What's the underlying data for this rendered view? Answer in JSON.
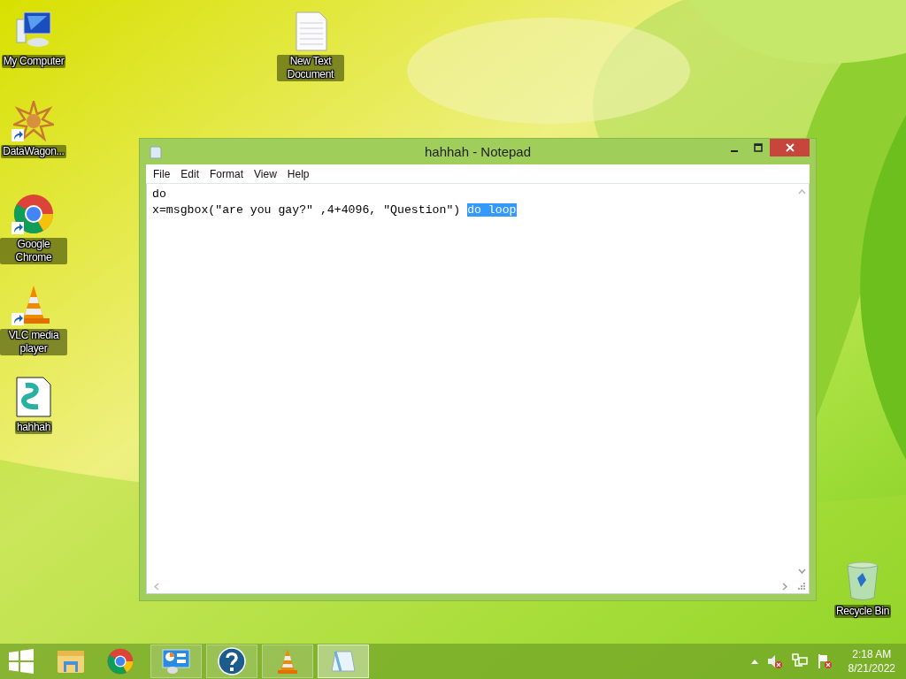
{
  "desktop_icons": [
    {
      "label": "My Computer",
      "shortcut": false
    },
    {
      "label": "DataWagon...",
      "shortcut": true
    },
    {
      "label": "Google Chrome",
      "shortcut": true
    },
    {
      "label": "VLC media player",
      "shortcut": true
    },
    {
      "label": "hahhah",
      "shortcut": false
    },
    {
      "label": "New Text Document",
      "shortcut": false
    },
    {
      "label": "Recycle Bin",
      "shortcut": false
    }
  ],
  "window": {
    "title": "hahhah - Notepad",
    "menu": [
      "File",
      "Edit",
      "Format",
      "View",
      "Help"
    ],
    "lines": [
      {
        "text": "do"
      },
      {
        "text": "x=msgbox(\"are you gay?\" ,4+4096, \"Question\") ",
        "selection": "do loop"
      }
    ]
  },
  "taskbar": {
    "items": [
      {
        "running": false,
        "active": false
      },
      {
        "running": false,
        "active": false
      },
      {
        "running": false,
        "active": false
      },
      {
        "running": true,
        "active": false
      },
      {
        "running": true,
        "active": false
      },
      {
        "running": true,
        "active": false
      },
      {
        "running": true,
        "active": true
      }
    ],
    "time": "2:18 AM",
    "date": "8/21/2022"
  }
}
